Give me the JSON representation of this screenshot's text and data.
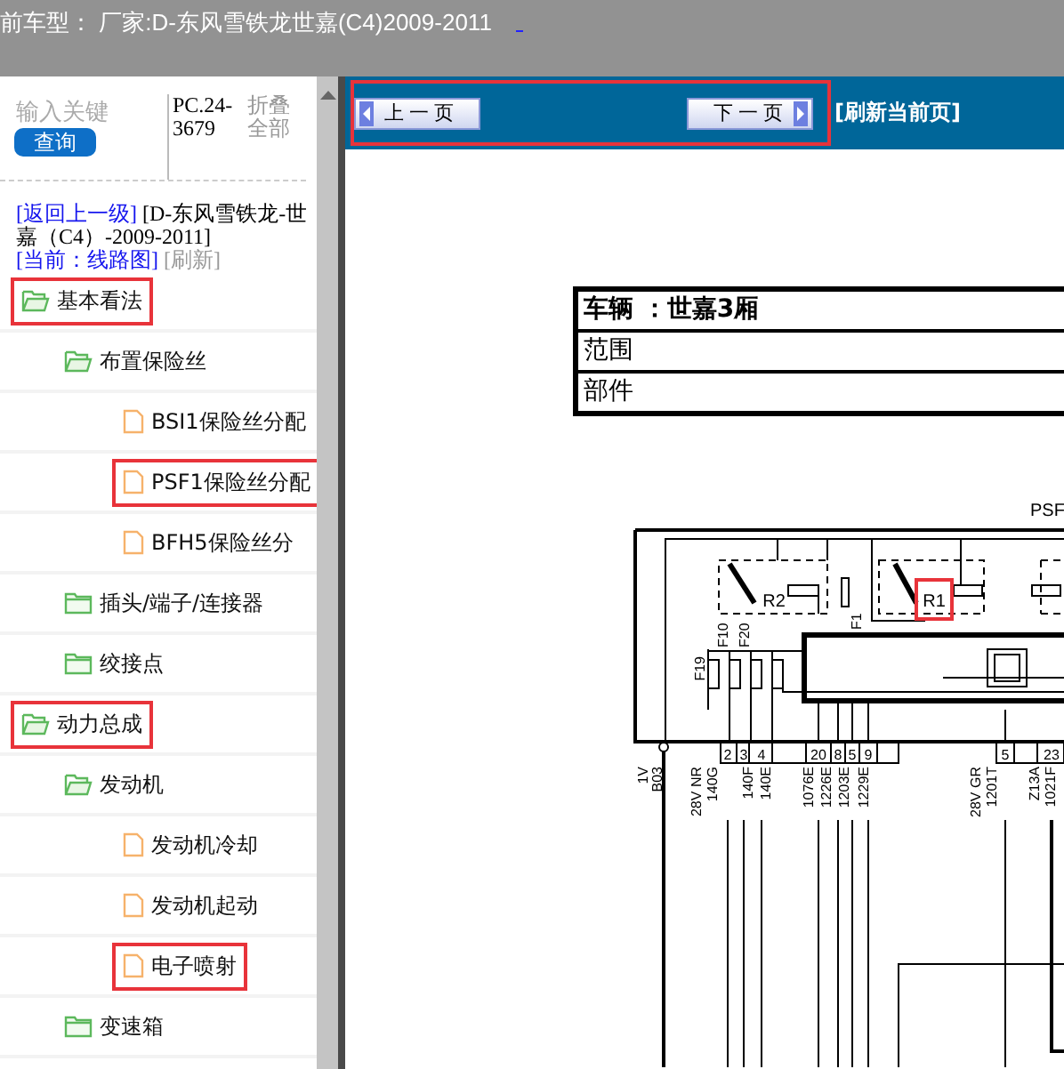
{
  "header": {
    "title": "前车型：  厂家:D-东风雪铁龙世嘉(C4)2009-2011"
  },
  "sidebar": {
    "search": {
      "placeholder": "输入关键"
    },
    "search_button": "查询",
    "code": "PC.24-3679",
    "collapse_all": "折叠全部",
    "breadcrumb": {
      "back": "[返回上一级]",
      "model": "[D-东风雪铁龙-世嘉（C4）-2009-2011]",
      "current": "[当前：线路图]",
      "refresh": "[刷新]"
    },
    "tree": [
      {
        "label": "基本看法",
        "kind": "folder",
        "expanded": true,
        "highlighted": true,
        "children": [
          {
            "label": "布置保险丝",
            "kind": "folder",
            "expanded": true,
            "highlighted": false,
            "children": [
              {
                "label": "BSI1保险丝分配",
                "kind": "file",
                "highlighted": false
              },
              {
                "label": "PSF1保险丝分配",
                "kind": "file",
                "highlighted": true
              },
              {
                "label": "BFH5保险丝分",
                "kind": "file",
                "highlighted": false
              }
            ]
          },
          {
            "label": "插头/端子/连接器",
            "kind": "folder",
            "expanded": false,
            "highlighted": false
          },
          {
            "label": "绞接点",
            "kind": "folder",
            "expanded": false,
            "highlighted": false
          }
        ]
      },
      {
        "label": "动力总成",
        "kind": "folder",
        "expanded": true,
        "highlighted": true,
        "children": [
          {
            "label": "发动机",
            "kind": "folder",
            "expanded": true,
            "highlighted": false,
            "children": [
              {
                "label": "发动机冷却",
                "kind": "file",
                "highlighted": false
              },
              {
                "label": "发动机起动",
                "kind": "file",
                "highlighted": false
              },
              {
                "label": "电子喷射",
                "kind": "file",
                "highlighted": true
              }
            ]
          },
          {
            "label": "变速箱",
            "kind": "folder",
            "expanded": false,
            "highlighted": false
          }
        ]
      }
    ]
  },
  "toolbar": {
    "prev": "上 一 页",
    "next": "下 一 页",
    "refresh": "[刷新当前页]",
    "highlighted": true
  },
  "document": {
    "info_rows": [
      "车辆 ：世嘉3厢",
      "范围",
      "部件"
    ],
    "diagram": {
      "title": "PSF",
      "relays": [
        {
          "label": "R2",
          "highlighted": false
        },
        {
          "label": "R1",
          "highlighted": true
        }
      ],
      "fuses": [
        "F19",
        "F10",
        "F20",
        "F1"
      ],
      "pins": [
        "2",
        "3",
        "4",
        "20",
        "8",
        "5",
        "9",
        "5",
        "23"
      ],
      "wires": [
        "1V",
        "B03",
        "28V NR",
        "140G",
        "140F",
        "140E",
        "1076E",
        "1226E",
        "1203E",
        "1229E",
        "28V GR",
        "1201T",
        "Z13A",
        "1021F"
      ]
    }
  }
}
